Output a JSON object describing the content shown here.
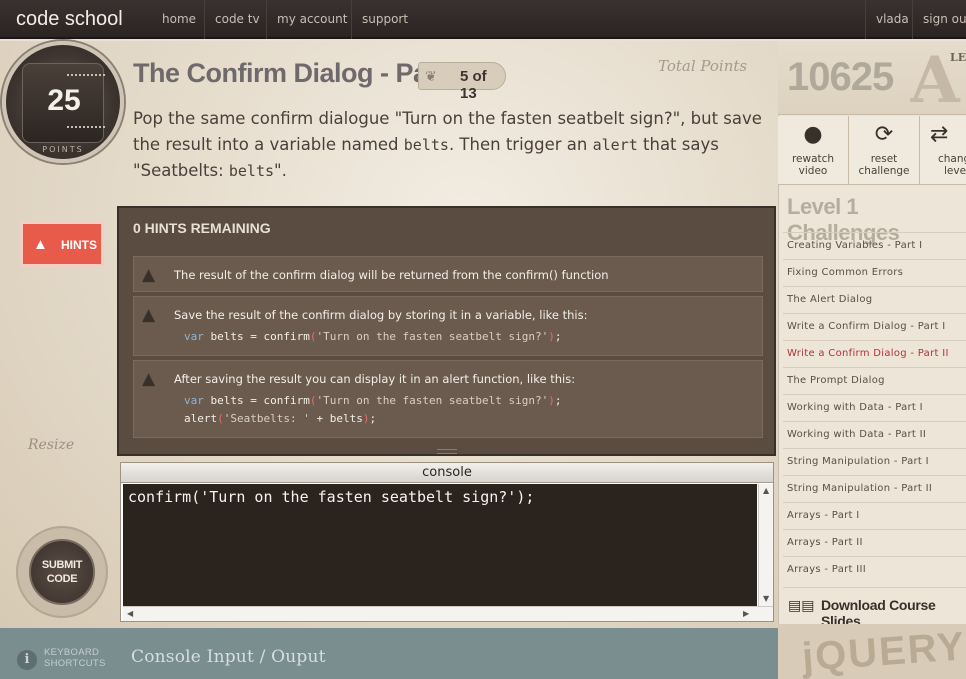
{
  "nav": {
    "logo": "code school",
    "items": [
      "home",
      "code tv",
      "my account",
      "support"
    ],
    "user": "vlada",
    "signout": "sign out"
  },
  "points": {
    "value": "25",
    "label": "POINTS"
  },
  "challenge": {
    "title": "The Confirm Dialog - Part II",
    "progress": "5 of 13",
    "description_parts": {
      "p1": "Pop the same confirm dialogue \"Turn on the fasten seatbelt sign?\", but save the result into a variable named ",
      "c1": "belts",
      "p2": ". Then trigger an ",
      "c2": "alert",
      "p3": " that says \"Seatbelts: ",
      "c3": "belts",
      "p4": "\"."
    }
  },
  "total_points_label": "Total Points",
  "hints_button": "HINTS",
  "resize_label": "Resize",
  "hints": {
    "title": "0 HINTS REMAINING",
    "items": [
      {
        "text": "The result of the confirm dialog will be returned from the confirm() function"
      },
      {
        "text": "Save the result of the confirm dialog by storing it in a variable, like this:",
        "code1": {
          "kw": "var",
          "rest": " belts = confirm",
          "p1": "(",
          "str": "'Turn on the fasten seatbelt sign?'",
          "p2": ")",
          "end": ";"
        }
      },
      {
        "text": "After saving the result you can display it in an alert function, like this:",
        "code1": {
          "kw": "var",
          "rest": " belts = confirm",
          "p1": "(",
          "str": "'Turn on the fasten seatbelt sign?'",
          "p2": ")",
          "end": ";"
        },
        "code2": {
          "rest": "alert",
          "p1": "(",
          "str": "'Seatbelts: '",
          "mid": " + belts",
          "p2": ")",
          "end": ";"
        }
      }
    ]
  },
  "console": {
    "header": "console",
    "input": "confirm('Turn on the fasten seatbelt sign?');"
  },
  "submit_label_1": "SUBMIT",
  "submit_label_2": "CODE",
  "bottom": {
    "kbd_1": "KEYBOARD",
    "kbd_2": "SHORTCUTS",
    "console_label": "Console Input / Ouput"
  },
  "sidebar": {
    "score": "10625",
    "score_art_letter": "A",
    "score_art_small": "LE",
    "actions": [
      {
        "label_1": "rewatch",
        "label_2": "video",
        "icon": "video-camera-icon"
      },
      {
        "label_1": "reset",
        "label_2": "challenge",
        "icon": "reset-icon"
      },
      {
        "label_1": "change",
        "label_2": "level",
        "icon": "change-arrows-icon"
      }
    ],
    "level_title": "Level 1 Challenges",
    "challenges": [
      "Creating Variables - Part I",
      "Fixing Common Errors",
      "The Alert Dialog",
      "Write a Confirm Dialog - Part I",
      "Write a Confirm Dialog - Part II",
      "The Prompt Dialog",
      "Working with Data - Part I",
      "Working with Data - Part II",
      "String Manipulation - Part I",
      "String Manipulation - Part II",
      "Arrays - Part I",
      "Arrays - Part II",
      "Arrays - Part III"
    ],
    "active_index": 4,
    "download": "Download Course Slides",
    "jquery_art": "jQUERY"
  },
  "colors": {
    "active_challenge": "#b2323a",
    "hints_button": "#e85a4a",
    "console_bg": "#2a231e"
  }
}
